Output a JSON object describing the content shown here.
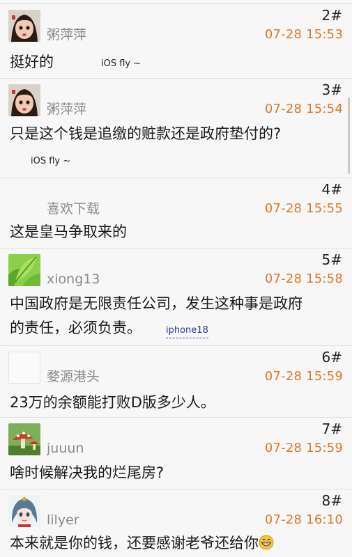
{
  "posts": [
    {
      "floor": "2#",
      "username": "粥萍萍",
      "time": "07-28 15:53",
      "content": "挺好的",
      "signature": "iOS fly ~",
      "avatar": "girl-avatar-icon"
    },
    {
      "floor": "3#",
      "username": "粥萍萍",
      "time": "07-28 15:54",
      "content": "只是这个钱是追缴的赃款还是政府垫付的?",
      "signature": "iOS fly ~",
      "avatar": "girl-avatar-icon"
    },
    {
      "floor": "4#",
      "username": "喜欢下载",
      "time": "07-28 15:55",
      "content": "这是皇马争取来的",
      "avatar": "none"
    },
    {
      "floor": "5#",
      "username": "xiong13",
      "time": "07-28 15:58",
      "content_line1": "中国政府是无限责任公司，发生这种事是政府",
      "content_line2": "的责任，必须负责。",
      "signature": "iphone18",
      "avatar": "leaf-avatar-icon"
    },
    {
      "floor": "6#",
      "username": "婺源港头",
      "time": "07-28 15:59",
      "content": "23万的余额能打败D版多少人。",
      "avatar": "blank-avatar-icon"
    },
    {
      "floor": "7#",
      "username": "juuun",
      "time": "07-28 15:59",
      "content": "啥时候解决我的烂尾房?",
      "avatar": "mushroom-avatar-icon"
    },
    {
      "floor": "8#",
      "username": "lilyer",
      "time": "07-28 16:10",
      "content": "本来就是你的钱，还要感谢老爷还给你",
      "emoji": "grinning-face-icon",
      "avatar": "anime-avatar-icon"
    }
  ],
  "colors": {
    "background": "#f7f7f7",
    "time": "#e0772a",
    "username": "#8a8a8a",
    "divider": "#e2e2e2",
    "link": "#2a3a9a"
  }
}
